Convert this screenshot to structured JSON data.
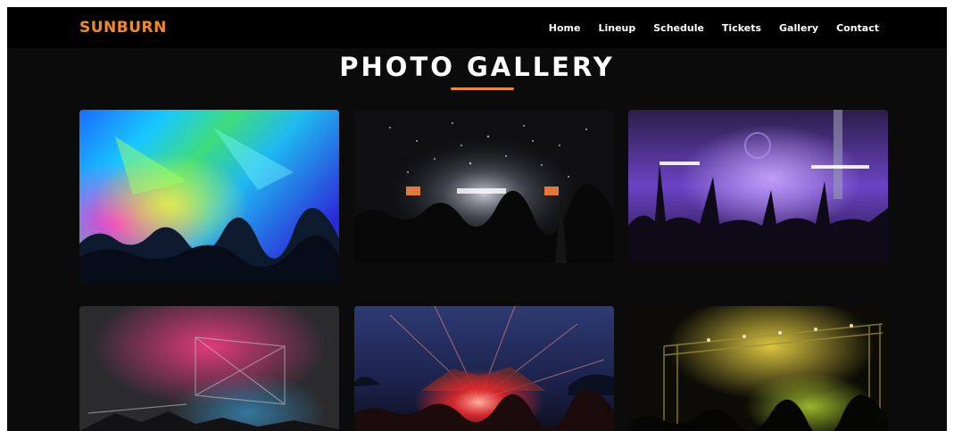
{
  "brand": {
    "name": "SUNBURN",
    "color": "#f08a24"
  },
  "nav": {
    "items": [
      {
        "label": "Home"
      },
      {
        "label": "Lineup"
      },
      {
        "label": "Schedule"
      },
      {
        "label": "Tickets"
      },
      {
        "label": "Gallery"
      },
      {
        "label": "Contact"
      }
    ]
  },
  "gallery": {
    "title": "PHOTO GALLERY",
    "accent_color": "#f08a24",
    "photos": [
      {
        "name": "gallery-photo-colorful-lights-crowd"
      },
      {
        "name": "gallery-photo-confetti-stage"
      },
      {
        "name": "gallery-photo-purple-stage-hands"
      },
      {
        "name": "gallery-photo-pink-smoke-truss"
      },
      {
        "name": "gallery-photo-red-laser-tent"
      },
      {
        "name": "gallery-photo-yellow-lit-stage"
      }
    ]
  },
  "colors": {
    "background": "#0b0b0b",
    "navbar": "#000000",
    "text": "#ffffff"
  }
}
